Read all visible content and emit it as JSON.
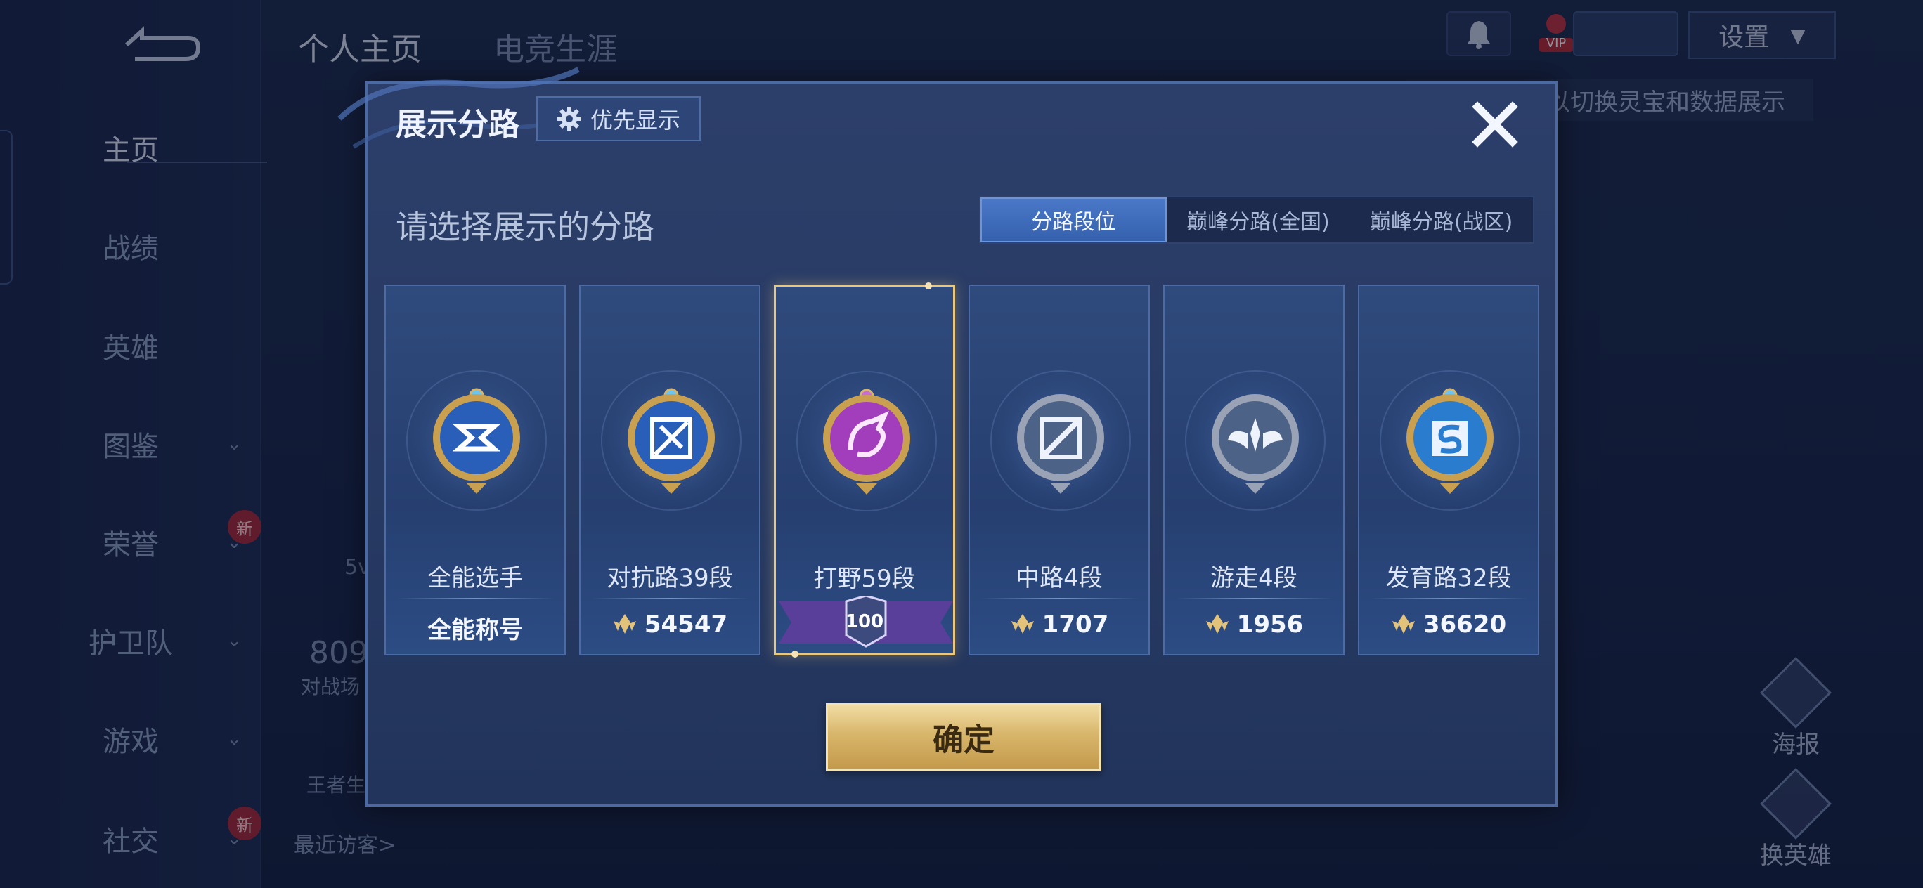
{
  "sidebar": {
    "items": [
      {
        "label": "主页",
        "active": true
      },
      {
        "label": "战绩"
      },
      {
        "label": "英雄"
      },
      {
        "label": "图鉴",
        "dropdown": true
      },
      {
        "label": "荣誉",
        "dropdown": true,
        "badge": "新"
      },
      {
        "label": "护卫队",
        "dropdown": true
      },
      {
        "label": "游戏",
        "dropdown": true
      },
      {
        "label": "社交",
        "dropdown": true,
        "badge": "新"
      }
    ]
  },
  "header": {
    "tabs": [
      "个人主页",
      "电竞生涯"
    ],
    "settings_label": "设置",
    "vip_label": "VIP",
    "hint_text": "以切换灵宝和数据展示"
  },
  "background": {
    "stat_value": "809",
    "stat_caption": "对战场",
    "side_fragment": "5v",
    "small_label": "王者生",
    "recent_visitors": "最近访客>"
  },
  "right_buttons": {
    "poster": "海报",
    "change_hero": "换英雄"
  },
  "modal": {
    "title": "展示分路",
    "priority_label": "优先显示",
    "subtitle": "请选择展示的分路",
    "segments": [
      "分路段位",
      "巅峰分路(全国)",
      "巅峰分路(战区)"
    ],
    "active_segment": 0,
    "confirm_label": "确定",
    "cards": [
      {
        "name": "全能选手",
        "value": "全能称号",
        "has_icon": false,
        "tier": "gold"
      },
      {
        "name": "对抗路39段",
        "value": "54547",
        "has_icon": true,
        "tier": "gold"
      },
      {
        "name": "打野59段",
        "value": "100",
        "has_icon": false,
        "tier": "purple",
        "selected": true
      },
      {
        "name": "中路4段",
        "value": "1707",
        "has_icon": true,
        "tier": "silver"
      },
      {
        "name": "游走4段",
        "value": "1956",
        "has_icon": true,
        "tier": "silver"
      },
      {
        "name": "发育路32段",
        "value": "36620",
        "has_icon": true,
        "tier": "gold"
      }
    ]
  },
  "colors": {
    "accent_gold": "#e9c77f",
    "accent_blue": "#3561ad",
    "panel": "#273a63"
  }
}
